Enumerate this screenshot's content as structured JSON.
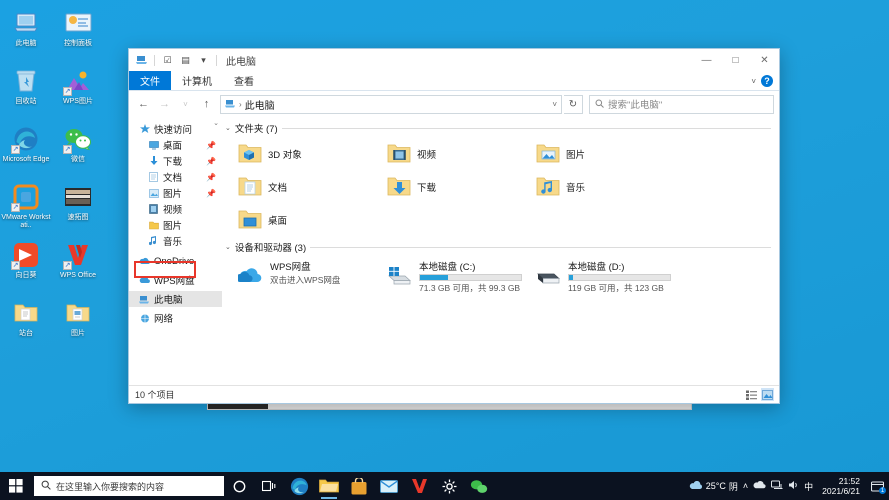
{
  "desktop": {
    "icons": [
      {
        "label": "此电脑",
        "icon": "computer-icon",
        "shortcut": false
      },
      {
        "label": "控制面板",
        "icon": "control-panel-icon",
        "shortcut": false
      },
      {
        "label": "回收站",
        "icon": "recycle-bin-icon",
        "shortcut": false
      },
      {
        "label": "WPS图片",
        "icon": "wps-photo-icon",
        "shortcut": true
      },
      {
        "label": "Microsoft Edge",
        "icon": "edge-icon",
        "shortcut": true
      },
      {
        "label": "微信",
        "icon": "wechat-icon",
        "shortcut": true
      },
      {
        "label": "VMware Workstati..",
        "icon": "vmware-icon",
        "shortcut": true
      },
      {
        "label": "速拓图",
        "icon": "app-icon",
        "shortcut": false
      },
      {
        "label": "向日葵",
        "icon": "sunlogin-icon",
        "shortcut": true
      },
      {
        "label": "WPS Office",
        "icon": "wps-office-icon",
        "shortcut": true
      },
      {
        "label": "站台",
        "icon": "folder-icon",
        "shortcut": false
      },
      {
        "label": "图片",
        "icon": "folder-icon",
        "shortcut": false
      }
    ]
  },
  "explorer": {
    "title": "此电脑",
    "quick_access_toolbar": [
      {
        "name": "properties-icon",
        "glyph": "◪"
      },
      {
        "name": "new-folder-icon",
        "glyph": "☑"
      },
      {
        "name": "undo-icon",
        "glyph": "▤"
      },
      {
        "name": "customize-icon",
        "glyph": "▾"
      }
    ],
    "window_buttons": {
      "minimize": "—",
      "maximize": "□",
      "close": "✕",
      "ribbon_toggle": "˅",
      "help": "?"
    },
    "tabs": [
      {
        "label": "文件",
        "active": true
      },
      {
        "label": "计算机",
        "active": false
      },
      {
        "label": "查看",
        "active": false
      }
    ],
    "navigation": {
      "back": "←",
      "forward": "→",
      "recent": "˅",
      "up": "↑",
      "refresh": "↻",
      "dropdown": "˅"
    },
    "address": {
      "icon": "this-pc-icon",
      "separator": "›",
      "path": "此电脑"
    },
    "search": {
      "placeholder": "搜索\"此电脑\""
    },
    "sidebar": {
      "items": [
        {
          "label": "快速访问",
          "icon": "star-icon",
          "indent": false,
          "pinned": false,
          "selected": false,
          "chevron": true
        },
        {
          "label": "桌面",
          "icon": "desktop-icon",
          "indent": true,
          "pinned": true,
          "selected": false
        },
        {
          "label": "下载",
          "icon": "download-icon",
          "indent": true,
          "pinned": true,
          "selected": false
        },
        {
          "label": "文档",
          "icon": "documents-icon",
          "indent": true,
          "pinned": true,
          "selected": false
        },
        {
          "label": "图片",
          "icon": "pictures-icon",
          "indent": true,
          "pinned": true,
          "selected": false
        },
        {
          "label": "视频",
          "icon": "videos-icon",
          "indent": true,
          "pinned": false,
          "selected": false
        },
        {
          "label": "图片",
          "icon": "folder-icon",
          "indent": true,
          "pinned": false,
          "selected": false
        },
        {
          "label": "音乐",
          "icon": "music-icon",
          "indent": true,
          "pinned": false,
          "selected": false
        },
        {
          "label": "OneDrive",
          "icon": "onedrive-icon",
          "indent": false,
          "pinned": false,
          "selected": false,
          "chevron": true
        },
        {
          "label": "WPS网盘",
          "icon": "wps-cloud-icon",
          "indent": false,
          "pinned": false,
          "selected": false
        },
        {
          "label": "此电脑",
          "icon": "this-pc-icon",
          "indent": false,
          "pinned": false,
          "selected": true
        },
        {
          "label": "网络",
          "icon": "network-icon",
          "indent": false,
          "pinned": false,
          "selected": false
        }
      ]
    },
    "groups": [
      {
        "header": "文件夹 (7)",
        "items": [
          {
            "label": "3D 对象",
            "icon": "folder-3d-icon"
          },
          {
            "label": "视频",
            "icon": "folder-videos-icon"
          },
          {
            "label": "图片",
            "icon": "folder-pictures-icon"
          },
          {
            "label": "文档",
            "icon": "folder-documents-icon"
          },
          {
            "label": "下载",
            "icon": "folder-downloads-icon"
          },
          {
            "label": "音乐",
            "icon": "folder-music-icon"
          },
          {
            "label": "桌面",
            "icon": "folder-desktop-icon"
          }
        ]
      }
    ],
    "devices_group": {
      "header": "设备和驱动器 (3)",
      "items": [
        {
          "name": "WPS网盘",
          "icon": "wps-cloud-icon",
          "subtitle": "双击进入WPS网盘",
          "has_bar": false
        },
        {
          "name": "本地磁盘 (C:)",
          "icon": "windows-drive-icon",
          "subtitle": "71.3 GB 可用，共 99.3 GB",
          "has_bar": true,
          "used_percent": 28,
          "bar_color": "#26a0da"
        },
        {
          "name": "本地磁盘 (D:)",
          "icon": "drive-icon",
          "subtitle": "119 GB 可用，共 123 GB",
          "has_bar": true,
          "used_percent": 4,
          "bar_color": "#26a0da"
        }
      ]
    },
    "status": {
      "item_count": "10 个项目",
      "view_details": "☷",
      "view_large_icons": "▦"
    }
  },
  "taskbar": {
    "start": "start-icon",
    "search_placeholder": "在这里输入你要搜索的内容",
    "buttons": [
      {
        "name": "cortana-icon",
        "glyph": "○"
      },
      {
        "name": "task-view-icon",
        "glyph": "◫"
      },
      {
        "name": "edge-icon",
        "glyph": "e"
      },
      {
        "name": "file-explorer-icon",
        "glyph": "▰"
      },
      {
        "name": "microsoft-store-icon",
        "glyph": "▤"
      },
      {
        "name": "mail-icon",
        "glyph": "✉"
      },
      {
        "name": "wps-office-icon",
        "glyph": "W"
      },
      {
        "name": "settings-icon",
        "glyph": "⚙"
      },
      {
        "name": "wechat-icon",
        "glyph": "●"
      }
    ],
    "tray": {
      "weather_temp": "25°C",
      "weather_desc": "阴",
      "expand": "˄",
      "onedrive": "☁",
      "network": "▭",
      "volume": "◁",
      "ime": "中",
      "time": "21:52",
      "date": "2021/6/21",
      "notification_badge": "1"
    }
  }
}
